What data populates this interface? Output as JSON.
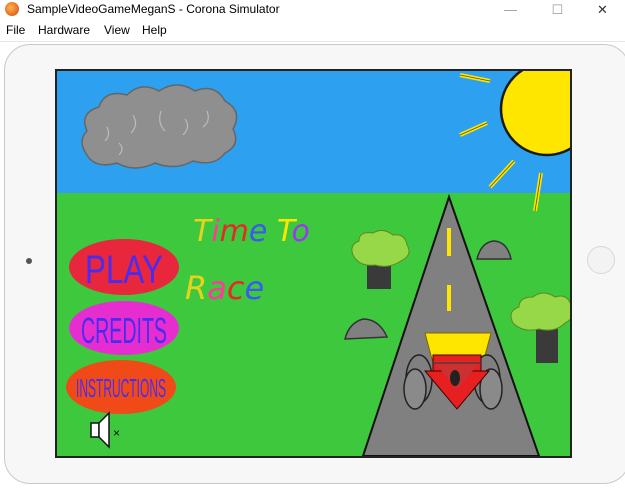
{
  "window": {
    "title": "SampleVideoGameMeganS - Corona Simulator",
    "app_icon": "corona-simulator-icon",
    "controls": {
      "minimize": "—",
      "maximize": "☐",
      "close": "✕"
    }
  },
  "menu": {
    "items": [
      "File",
      "Hardware",
      "View",
      "Help"
    ]
  },
  "game": {
    "title_line1": "Time To",
    "title_line2": "Race",
    "buttons": {
      "play": "PLAY",
      "credits": "CREDITS",
      "instructions": "INSTRUCTIONS"
    },
    "mute_icon": "speaker-muted-icon",
    "mute_mark": "×",
    "colors": {
      "sky": "#2ea0f0",
      "grass": "#3ec83e",
      "sun": "#ffe600",
      "road": "#808080",
      "play_button": "#e8273c",
      "credits_button": "#e62ed0",
      "instructions_button": "#f04a18",
      "button_text": "#4a2cf0"
    }
  }
}
